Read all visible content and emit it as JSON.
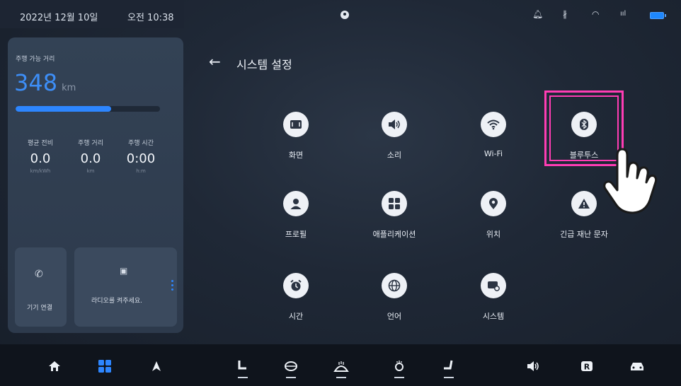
{
  "status_bar": {
    "date": "2022년 12월 10일",
    "time": "오전 10:38",
    "icons": [
      "profile-icon",
      "bell-icon",
      "bluetooth-icon",
      "wifi-icon",
      "signal-icon",
      "battery-icon"
    ]
  },
  "drive_panel": {
    "range_label": "주행 가능 거리",
    "range_value": "348",
    "range_unit": "km",
    "range_level": 0.66,
    "stats": [
      {
        "label": "평균 전비",
        "value": "0.0",
        "unit": "km/kWh"
      },
      {
        "label": "주행 거리",
        "value": "0.0",
        "unit": "km"
      },
      {
        "label": "주행 시간",
        "value": "0:00",
        "unit": "h:m"
      }
    ],
    "phone_tile": {
      "label": "기기 연결",
      "icon": "phone-icon"
    },
    "radio_tile": {
      "label": "라디오를 켜주세요.",
      "icon": "radio-icon"
    }
  },
  "header": {
    "back_icon": "back-arrow-icon",
    "title": "시스템 설정"
  },
  "settings": [
    {
      "label": "화면",
      "icon": "display-icon"
    },
    {
      "label": "소리",
      "icon": "speaker-icon"
    },
    {
      "label": "Wi-Fi",
      "icon": "wifi-icon"
    },
    {
      "label": "블루투스",
      "icon": "bluetooth-icon",
      "highlighted": true
    },
    {
      "label": "프로필",
      "icon": "person-icon"
    },
    {
      "label": "애플리케이션",
      "icon": "apps-grid-icon"
    },
    {
      "label": "위치",
      "icon": "location-pin-icon"
    },
    {
      "label": "긴급 재난 문자",
      "icon": "warning-icon"
    },
    {
      "label": "시간",
      "icon": "alarm-clock-icon"
    },
    {
      "label": "언어",
      "icon": "globe-icon"
    },
    {
      "label": "시스템",
      "icon": "system-icon"
    }
  ],
  "dock": {
    "items": [
      "home-icon",
      "apps-icon",
      "navigation-icon",
      "seat-heat-icon",
      "steering-heat-icon",
      "defrost-icon",
      "seat-ventilation-icon",
      "seat-adjust-icon",
      "volume-icon",
      "camera-r-icon",
      "car-icon"
    ]
  },
  "colors": {
    "accent": "#2d86ff",
    "highlight": "#ff3db4",
    "background": "#1b2431"
  }
}
